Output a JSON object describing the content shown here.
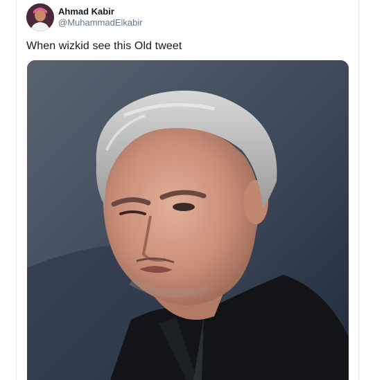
{
  "tweet": {
    "author": {
      "display_name": "Ahmad Kabir",
      "handle": "@MuhammadElkabir"
    },
    "text": "When wizkid see this Old tweet",
    "media": {
      "type": "photo"
    }
  },
  "colors": {
    "name": "#14171a",
    "handle": "#657786",
    "border": "#e6ecf0"
  }
}
